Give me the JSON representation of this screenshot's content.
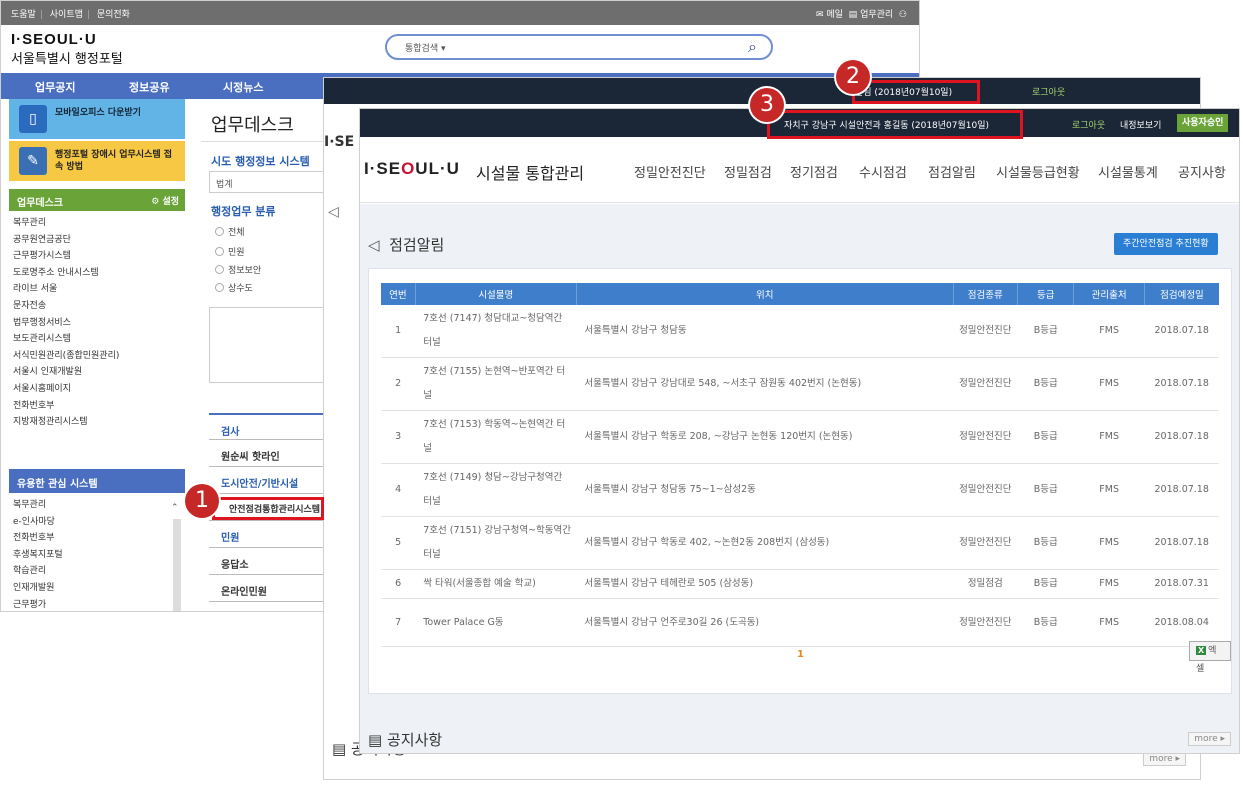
{
  "portal": {
    "util_links": [
      "도움말",
      "사이트맵",
      "문의전화"
    ],
    "util_right": [
      "메일",
      "업무관리"
    ],
    "logo": "I·SEOUL·U",
    "logo_sub": "서울특별시 행정포털",
    "search_scope": "통합검색",
    "nav": [
      "업무공지",
      "정보공유",
      "시정뉴스"
    ],
    "mobile_banner": "모바일오피스 다운받기",
    "guide_banner": "행정포털 장애시 업무시스템 접속 방법",
    "desk_panel_title": "업무데스크",
    "desk_panel_setting": "설정",
    "desk_links": [
      "복무관리",
      "공무원연금공단",
      "근무평가시스템",
      "도로명주소 안내시스템",
      "라이브 서울",
      "문자전송",
      "법무행정서비스",
      "보도관리시스템",
      "서식민원관리(종합민원관리)",
      "서울시 인재개발원",
      "서울시홈페이지",
      "전화번호부",
      "지방재정관리시스템"
    ],
    "useful_panel_title": "유용한 관심 시스템",
    "useful_links": [
      "복무관리",
      "e-인사마당",
      "전화번호부",
      "후생복지포털",
      "학습관리",
      "인재개발원",
      "근무평가"
    ],
    "main_title": "업무데스크",
    "sido_title": "시도 행정정보 시스템",
    "sido_value": "법계",
    "category_title": "행정업무 분류",
    "categories": [
      "전체",
      "민원",
      "정보보안",
      "상수도"
    ],
    "menu": [
      "검사",
      "원순씨 핫라인",
      "도시안전/기반시설",
      "안전점검통합관리시스템",
      "민원",
      "응답소",
      "온라인민원"
    ]
  },
  "window2": {
    "user": "손님 (2018년07월10일)",
    "logout": "로그아웃",
    "notice": "공지사항",
    "more": "more ▸"
  },
  "window3": {
    "user": "자치구 강남구 시설안전과 홍길동 (2018년07월10일)",
    "logout": "로그아웃",
    "info": "내정보보기",
    "approve": "사용자승인",
    "logo_prefix": "I·SE",
    "logo_o": "O",
    "logo_suffix": "UL·U",
    "app_name": "시설물 통합관리",
    "gnav": [
      "정밀안전진단",
      "정밀점검",
      "정기점검",
      "수시점검",
      "점검알림",
      "시설물등급현황",
      "시설물통계",
      "공지사항"
    ],
    "page_title": "점검알림",
    "weekly_button": "주간안전점검 추진현황",
    "columns": [
      "연번",
      "시설물명",
      "위치",
      "점검종류",
      "등급",
      "관리출처",
      "점검예정일"
    ],
    "rows": [
      {
        "no": "1",
        "name": "7호선 (7147) 청담대교~청담역간 터널",
        "loc": "서울특별시 강남구 청담동",
        "kind": "정밀안전진단",
        "grade": "B등급",
        "src": "FMS",
        "date": "2018.07.18"
      },
      {
        "no": "2",
        "name": "7호선 (7155) 논현역~반포역간 터널",
        "loc": "서울특별시 강남구 강남대로 548, ~서초구 잠원동 402번지 (논현동)",
        "kind": "정밀안전진단",
        "grade": "B등급",
        "src": "FMS",
        "date": "2018.07.18"
      },
      {
        "no": "3",
        "name": "7호선 (7153) 학동역~논현역간 터널",
        "loc": "서울특별시 강남구 학동로 208, ~강남구 논현동 120번지 (논현동)",
        "kind": "정밀안전진단",
        "grade": "B등급",
        "src": "FMS",
        "date": "2018.07.18"
      },
      {
        "no": "4",
        "name": "7호선 (7149) 청담~강남구청역간 터널",
        "loc": "서울특별시 강남구 청담동 75~1~삼성2동",
        "kind": "정밀안전진단",
        "grade": "B등급",
        "src": "FMS",
        "date": "2018.07.18"
      },
      {
        "no": "5",
        "name": "7호선 (7151) 강남구청역~학동역간 터널",
        "loc": "서울특별시 강남구 학동로 402, ~논현2동 208번지 (삼성동)",
        "kind": "정밀안전진단",
        "grade": "B등급",
        "src": "FMS",
        "date": "2018.07.18"
      },
      {
        "no": "6",
        "name": "싹 타워(서울종합 예술 학교)",
        "loc": "서울특별시 강남구 테헤란로 505 (삼성동)",
        "kind": "정밀점검",
        "grade": "B등급",
        "src": "FMS",
        "date": "2018.07.31"
      },
      {
        "no": "7",
        "name": "Tower Palace G동",
        "loc": "서울특별시 강남구 언주로30길 26 (도곡동)",
        "kind": "정밀안전진단",
        "grade": "B등급",
        "src": "FMS",
        "date": "2018.08.04"
      }
    ],
    "page": "1",
    "excel": "엑셀",
    "notice": "공지사항",
    "more": "more ▸"
  },
  "annotations": [
    "1",
    "2",
    "3"
  ]
}
